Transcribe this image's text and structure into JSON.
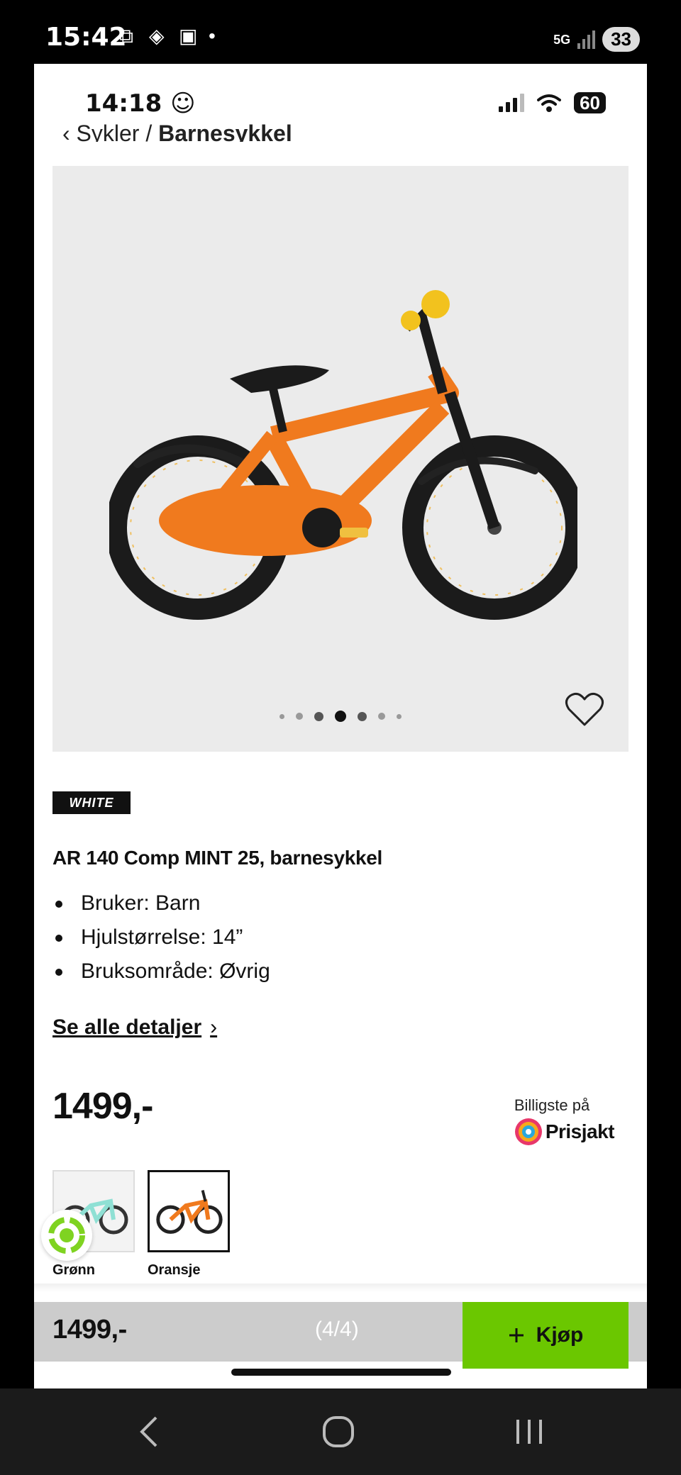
{
  "outer_status": {
    "time": "15:42",
    "network": "5G",
    "battery": "33"
  },
  "inner_status": {
    "time": "14:18 ☺",
    "battery": "60"
  },
  "breadcrumb": {
    "parent": "‹ Sykler /",
    "current": "Barnesykkel"
  },
  "gallery": {
    "dot_count": 7,
    "active_dot": 3
  },
  "product": {
    "brand": "WHITE",
    "title": "AR 140 Comp MINT 25, barnesykkel",
    "specs": [
      "Bruker: Barn",
      "Hjulstørrelse: 14”",
      "Bruksområde: Øvrig"
    ],
    "details_link": "Se alle detaljer",
    "price": "1499,-",
    "prisjakt_caption": "Billigste på",
    "prisjakt_name": "Prisjakt"
  },
  "variants": [
    {
      "label": "Grønn",
      "selected": false
    },
    {
      "label": "Oransje",
      "selected": true
    }
  ],
  "bottom_bar": {
    "price": "1499,-",
    "counter": "(4/4)",
    "buy_label": "Kjøp"
  },
  "colors": {
    "accent": "#6bc700",
    "bike_orange": "#f07a1e",
    "gallery_bg": "#ebebeb"
  }
}
